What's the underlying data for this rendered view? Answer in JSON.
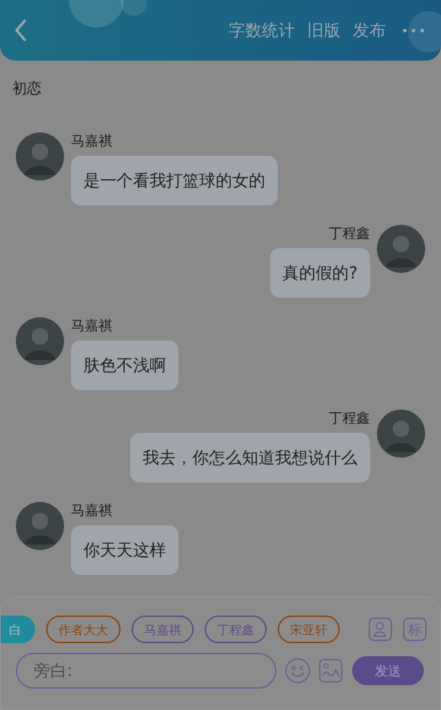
{
  "header": {
    "actions": [
      "字数统计",
      "旧版",
      "发布"
    ],
    "more": "•••"
  },
  "title": "初恋",
  "messages": [
    {
      "kind": "incoming",
      "sender": "马嘉祺",
      "text": "是一个看我打篮球的女的"
    },
    {
      "kind": "outgoing",
      "sender": "丁程鑫",
      "text": "真的假的?"
    },
    {
      "kind": "incoming",
      "sender": "马嘉祺",
      "text": "肤色不浅啊"
    },
    {
      "kind": "outgoing",
      "sender": "丁程鑫",
      "text": "我去，你怎么知道我想说什么"
    },
    {
      "kind": "incoming",
      "sender": "马嘉祺",
      "text": "你天天这样"
    }
  ],
  "roles": [
    {
      "label": "白",
      "selected": true,
      "color": "#1f8b9c"
    },
    {
      "label": "作者大大",
      "selected": false,
      "color": "#8a4512"
    },
    {
      "label": "马嘉祺",
      "selected": false,
      "color": "#5f4a86"
    },
    {
      "label": "丁程鑫",
      "selected": false,
      "color": "#5f4a86"
    },
    {
      "label": "宋亚轩",
      "selected": false,
      "color": "#8a4512"
    }
  ],
  "tag_button": "标",
  "input": {
    "placeholder": "旁白:"
  },
  "send": "发送"
}
